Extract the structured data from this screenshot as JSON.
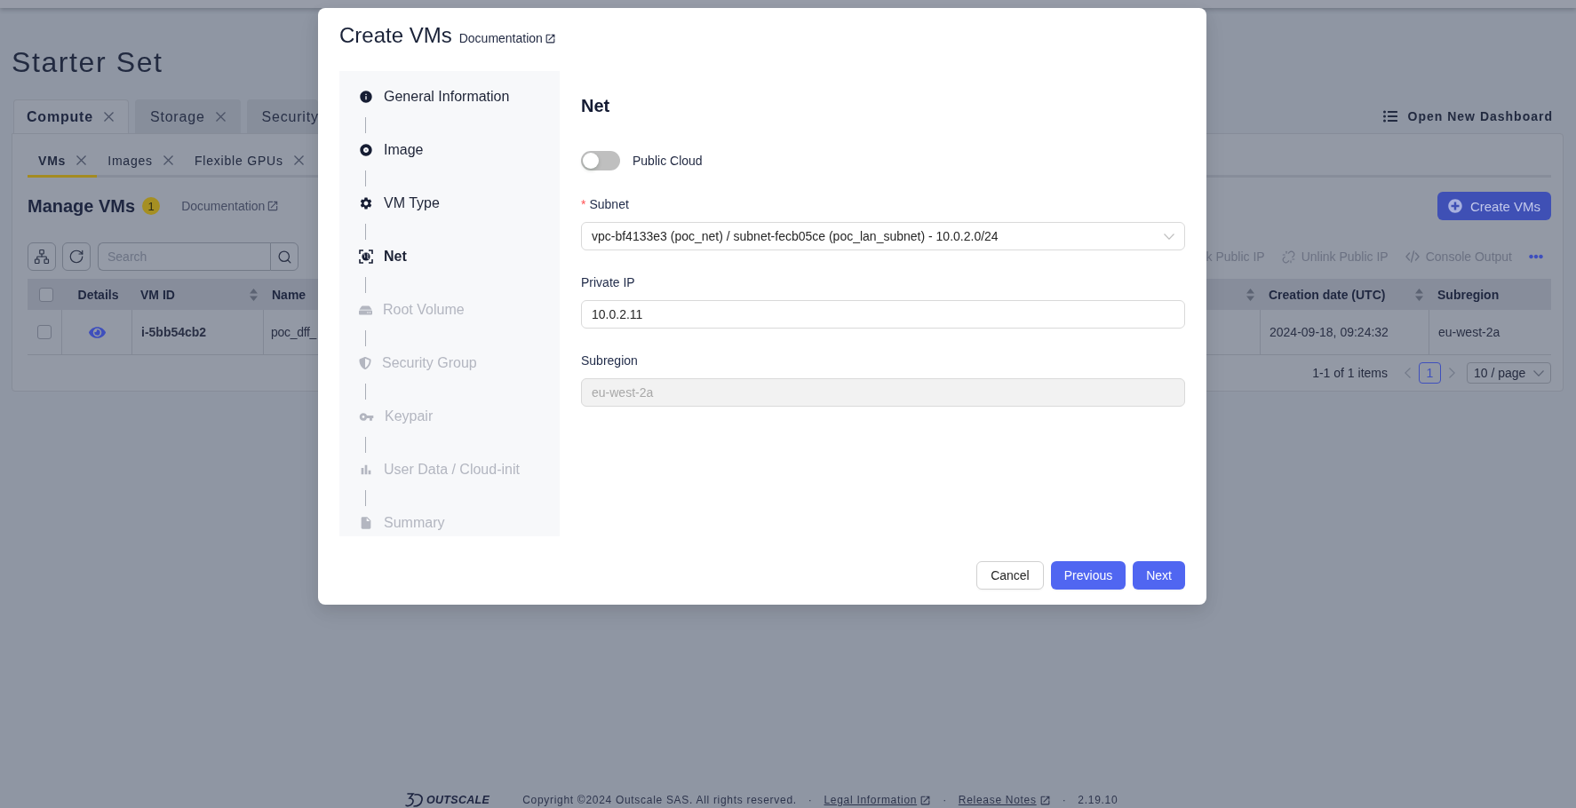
{
  "page": {
    "title": "Starter Set",
    "dashboard_button": "Open New Dashboard"
  },
  "tabs": [
    {
      "label": "Compute",
      "selected": true,
      "closable": true
    },
    {
      "label": "Storage",
      "selected": false,
      "closable": true
    },
    {
      "label": "Security",
      "selected": false,
      "closable": false
    }
  ],
  "subtabs": [
    {
      "label": "VMs",
      "selected": true,
      "closable": true
    },
    {
      "label": "Images",
      "selected": false,
      "closable": true
    },
    {
      "label": "Flexible GPUs",
      "selected": false,
      "closable": true
    }
  ],
  "section": {
    "title": "Manage VMs",
    "count": "1",
    "documentation": "Documentation",
    "create_button": "Create VMs"
  },
  "toolbar": {
    "search": {
      "placeholder": "Search"
    },
    "actions": [
      "k Public IP",
      "Unlink Public IP",
      "Console Output"
    ]
  },
  "table": {
    "header_checkbox": {
      "checked": false
    },
    "columns": [
      {
        "label": "Details",
        "sortable": false
      },
      {
        "label": "VM ID",
        "sortable": true
      },
      {
        "label": "Name",
        "sortable": false
      },
      {
        "sortable": true
      },
      {
        "label": "Creation date (UTC)",
        "sortable": true
      },
      {
        "label": "Subregion",
        "sortable": false
      }
    ],
    "rows": [
      {
        "checked": false,
        "vm_id": "i-5bb54cb2",
        "name": "poc_dff_",
        "creation_date": "2024-09-18, 09:24:32",
        "subregion": "eu-west-2a"
      }
    ]
  },
  "pagination": {
    "summary": "1-1 of 1 items",
    "pages": [
      {
        "label": "1",
        "selected": true
      }
    ],
    "page_size": "10 / page"
  },
  "footer": {
    "logo": "OUTSCALE",
    "items": [
      {
        "kind": "text",
        "label": "Copyright ©2024 Outscale SAS. All rights reserved."
      },
      {
        "kind": "separator",
        "label": "·"
      },
      {
        "kind": "link",
        "label": "Legal Information"
      },
      {
        "kind": "separator",
        "label": "·"
      },
      {
        "kind": "link",
        "label": "Release Notes"
      },
      {
        "kind": "separator",
        "label": "·"
      },
      {
        "kind": "text",
        "label": "2.19.10"
      }
    ]
  },
  "modal": {
    "title": "Create VMs",
    "documentation": "Documentation",
    "steps": [
      {
        "label": "General Information",
        "selected": false,
        "disabled": false
      },
      {
        "label": "Image",
        "selected": false,
        "disabled": false
      },
      {
        "label": "VM Type",
        "selected": false,
        "disabled": false
      },
      {
        "label": "Net",
        "selected": true,
        "disabled": false
      },
      {
        "label": "Root Volume",
        "selected": false,
        "disabled": true
      },
      {
        "label": "Security Group",
        "selected": false,
        "disabled": true
      },
      {
        "label": "Keypair",
        "selected": false,
        "disabled": true
      },
      {
        "label": "User Data / Cloud-init",
        "selected": false,
        "disabled": true
      },
      {
        "label": "Summary",
        "selected": false,
        "disabled": true
      }
    ],
    "form": {
      "heading": "Net",
      "switch": {
        "label": "Public Cloud",
        "on": false
      },
      "fields": [
        {
          "kind": "select",
          "label": "Subnet",
          "required_mark": "*",
          "value": "vpc-bf4133e3 (poc_net) / subnet-fecb05ce (poc_lan_subnet) - 10.0.2.0/24",
          "disabled": false
        },
        {
          "kind": "input",
          "label": "Private IP",
          "value": "10.0.2.11",
          "disabled": false
        },
        {
          "kind": "input",
          "label": "Subregion",
          "value": "eu-west-2a",
          "disabled": true
        }
      ]
    },
    "buttons": [
      {
        "label": "Cancel",
        "kind": "default"
      },
      {
        "label": "Previous",
        "kind": "primary"
      },
      {
        "label": "Next",
        "kind": "primary"
      }
    ]
  }
}
